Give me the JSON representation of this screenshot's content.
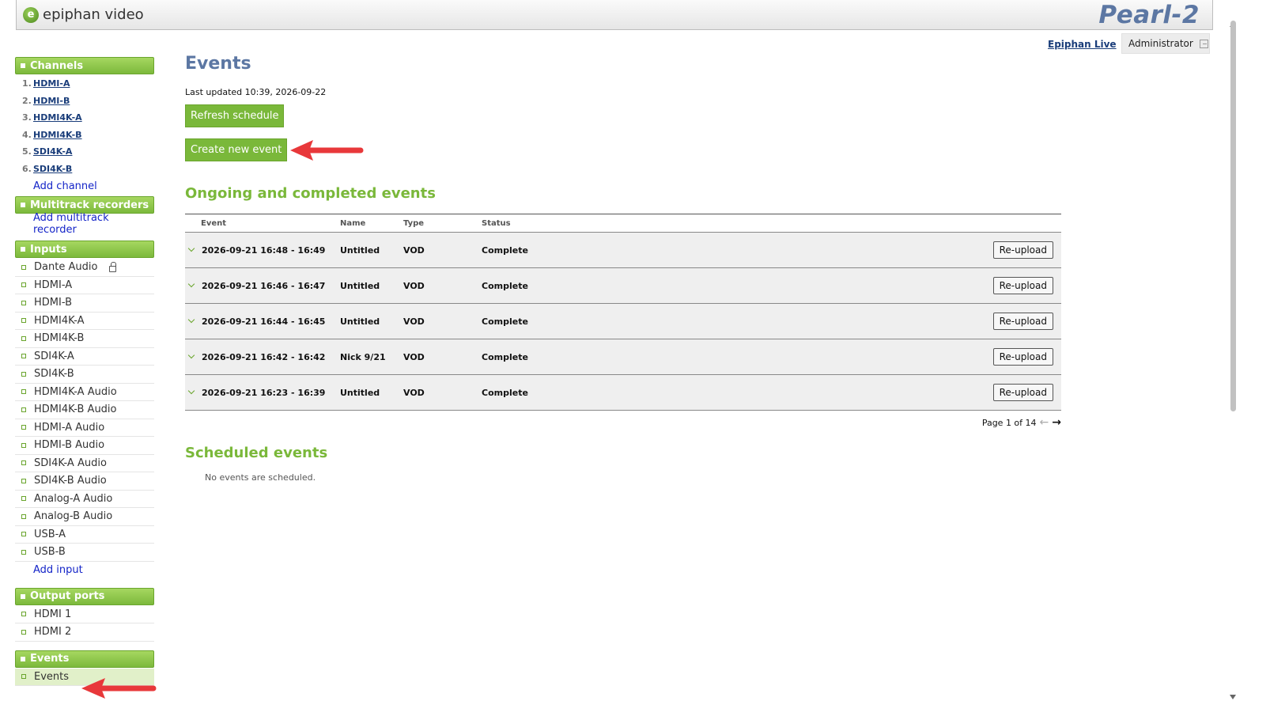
{
  "header": {
    "brand": "epiphan video",
    "logo_letter": "e",
    "product": "Pearl-2"
  },
  "topbar": {
    "epiphan_live": "Epiphan Live",
    "user": "Administrator"
  },
  "sidebar": {
    "channels_title": "Channels",
    "channels": [
      {
        "num": "1.",
        "label": "HDMI-A"
      },
      {
        "num": "2.",
        "label": "HDMI-B"
      },
      {
        "num": "3.",
        "label": "HDMI4K-A"
      },
      {
        "num": "4.",
        "label": "HDMI4K-B"
      },
      {
        "num": "5.",
        "label": "SDI4K-A"
      },
      {
        "num": "6.",
        "label": "SDI4K-B"
      }
    ],
    "add_channel": "Add channel",
    "multitrack_title": "Multitrack recorders",
    "add_multitrack": "Add multitrack recorder",
    "inputs_title": "Inputs",
    "inputs": [
      "Dante Audio",
      "HDMI-A",
      "HDMI-B",
      "HDMI4K-A",
      "HDMI4K-B",
      "SDI4K-A",
      "SDI4K-B",
      "HDMI4K-A Audio",
      "HDMI4K-B Audio",
      "HDMI-A Audio",
      "HDMI-B Audio",
      "SDI4K-A Audio",
      "SDI4K-B Audio",
      "Analog-A Audio",
      "Analog-B Audio",
      "USB-A",
      "USB-B"
    ],
    "add_input": "Add input",
    "outputs_title": "Output ports",
    "outputs": [
      "HDMI 1",
      "HDMI 2"
    ],
    "events_title": "Events",
    "events_item": "Events"
  },
  "main": {
    "title": "Events",
    "last_updated": "Last updated 10:39, 2026-09-22",
    "refresh_button": "Refresh schedule",
    "create_button": "Create new event",
    "ongoing_title": "Ongoing and completed events",
    "columns": {
      "event": "Event",
      "name": "Name",
      "type": "Type",
      "status": "Status"
    },
    "rows": [
      {
        "event": "2026-09-21 16:48 - 16:49",
        "name": "Untitled",
        "type": "VOD",
        "status": "Complete",
        "action": "Re-upload"
      },
      {
        "event": "2026-09-21 16:46 - 16:47",
        "name": "Untitled",
        "type": "VOD",
        "status": "Complete",
        "action": "Re-upload"
      },
      {
        "event": "2026-09-21 16:44 - 16:45",
        "name": "Untitled",
        "type": "VOD",
        "status": "Complete",
        "action": "Re-upload"
      },
      {
        "event": "2026-09-21 16:42 - 16:42",
        "name": "Nick 9/21",
        "type": "VOD",
        "status": "Complete",
        "action": "Re-upload"
      },
      {
        "event": "2026-09-21 16:23 - 16:39",
        "name": "Untitled",
        "type": "VOD",
        "status": "Complete",
        "action": "Re-upload"
      }
    ],
    "pager": "Page 1 of 14",
    "scheduled_title": "Scheduled events",
    "no_events": "No events are scheduled."
  },
  "colors": {
    "accent_green": "#7ab83a",
    "title_blue": "#5c77a3",
    "annotation_red": "#e8383a"
  }
}
